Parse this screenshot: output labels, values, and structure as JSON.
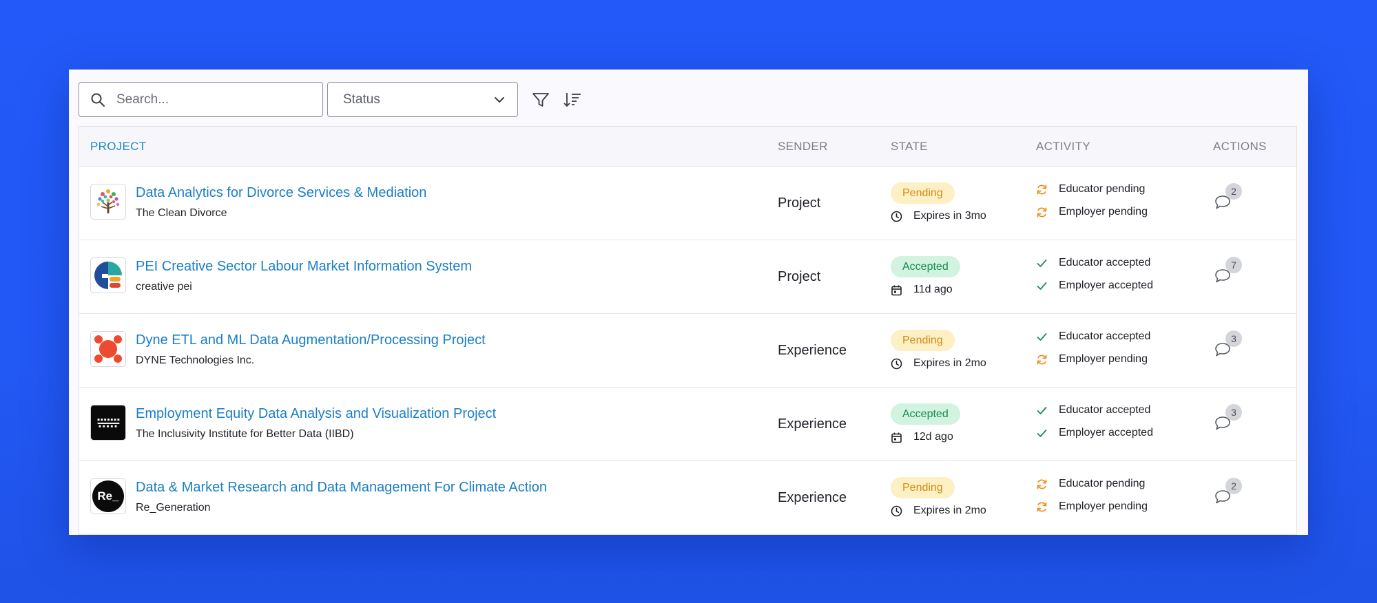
{
  "toolbar": {
    "search_placeholder": "Search...",
    "status_label": "Status"
  },
  "table": {
    "headers": {
      "project": "PROJECT",
      "sender": "SENDER",
      "state": "STATE",
      "activity": "ACTIVITY",
      "actions": "ACTIONS"
    },
    "rows": [
      {
        "title": "Data Analytics for Divorce Services & Mediation",
        "org": "The Clean Divorce",
        "logo": "tree-logo",
        "sender": "Project",
        "state": "Pending",
        "meta_icon": "clock-icon",
        "meta": "Expires in 3mo",
        "activity": [
          {
            "icon": "refresh-icon",
            "text": "Educator pending"
          },
          {
            "icon": "refresh-icon",
            "text": "Employer pending"
          }
        ],
        "comments": "2"
      },
      {
        "title": "PEI Creative Sector Labour Market Information System",
        "org": "creative pei",
        "logo": "creative-pei-logo",
        "sender": "Project",
        "state": "Accepted",
        "meta_icon": "calendar-icon",
        "meta": "11d ago",
        "activity": [
          {
            "icon": "check-icon",
            "text": "Educator accepted"
          },
          {
            "icon": "check-icon",
            "text": "Employer accepted"
          }
        ],
        "comments": "7"
      },
      {
        "title": "Dyne ETL and ML Data Augmentation/Processing Project",
        "org": "DYNE Technologies Inc.",
        "logo": "dyne-logo",
        "sender": "Experience",
        "state": "Pending",
        "meta_icon": "clock-icon",
        "meta": "Expires in 2mo",
        "activity": [
          {
            "icon": "check-icon",
            "text": "Educator accepted"
          },
          {
            "icon": "refresh-icon",
            "text": "Employer pending"
          }
        ],
        "comments": "3"
      },
      {
        "title": "Employment Equity Data Analysis and Visualization Project",
        "org": "The Inclusivity Institute for Better Data (IIBD)",
        "logo": "iibd-logo",
        "sender": "Experience",
        "state": "Accepted",
        "meta_icon": "calendar-icon",
        "meta": "12d ago",
        "activity": [
          {
            "icon": "check-icon",
            "text": "Educator accepted"
          },
          {
            "icon": "check-icon",
            "text": "Employer accepted"
          }
        ],
        "comments": "3"
      },
      {
        "title": "Data & Market Research and Data Management For Climate Action",
        "org": "Re_Generation",
        "logo": "re-generation-logo",
        "logo_text": "Re_",
        "sender": "Experience",
        "state": "Pending",
        "meta_icon": "clock-icon",
        "meta": "Expires in 2mo",
        "activity": [
          {
            "icon": "refresh-icon",
            "text": "Educator pending"
          },
          {
            "icon": "refresh-icon",
            "text": "Employer pending"
          }
        ],
        "comments": "2"
      }
    ]
  },
  "colors": {
    "background": "#2259f8",
    "link": "#1a7fc6",
    "pending_bg": "#fdf0c4",
    "pending_text": "#d38a12",
    "accepted_bg": "#d1f3e0",
    "accepted_text": "#168a4b",
    "activity_pending": "#f08a1c",
    "activity_accepted": "#1c8a4e"
  }
}
